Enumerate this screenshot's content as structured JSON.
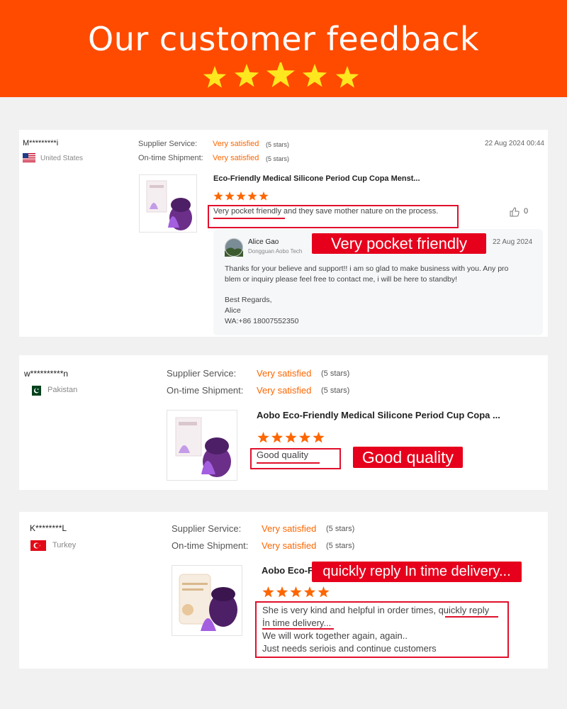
{
  "banner": {
    "title": "Our customer feedback",
    "rating_stars": 5,
    "star_color": "#ffe71f"
  },
  "colors": {
    "brand_orange": "#fe4b00",
    "satisfied_orange": "#fe6600",
    "highlight_red": "#e1102c"
  },
  "reviews": [
    {
      "buyer": "M*********i",
      "country": "United States",
      "supplier_label": "Supplier Service:",
      "supplier_value": "Very satisfied",
      "supplier_stars": "(5 stars)",
      "shipment_label": "On-time Shipment:",
      "shipment_value": "Very satisfied",
      "shipment_stars": "(5 stars)",
      "date": "22 Aug 2024 00:44",
      "product": "Eco-Friendly Medical Silicone Period Cup Copa Menst...",
      "rating": 5,
      "comment": "Very pocket friendly and they save mother nature on the process.",
      "likes": "0",
      "callout": "Very pocket friendly",
      "reply": {
        "name": "Alice Gao",
        "company": "Dongguan Aobo Tech",
        "date": "22 Aug 2024",
        "line1": "Thanks for your believe and support!! i am so glad to make business with you. Any pro",
        "line2": "blem or inquiry please feel free to contact me, i will be here to standby!",
        "line3": "Best Regards,",
        "line4": "Alice",
        "line5": "WA:+86 18007552350"
      }
    },
    {
      "buyer": "w**********n",
      "country": "Pakistan",
      "supplier_label": "Supplier Service:",
      "supplier_value": "Very satisfied",
      "supplier_stars": "(5 stars)",
      "shipment_label": "On-time Shipment:",
      "shipment_value": "Very satisfied",
      "shipment_stars": "(5 stars)",
      "product": "Aobo Eco-Friendly Medical Silicone Period Cup Copa ...",
      "rating": 5,
      "comment": "Good quality",
      "callout": "Good quality"
    },
    {
      "buyer": "K********L",
      "country": "Turkey",
      "supplier_label": "Supplier Service:",
      "supplier_value": "Very satisfied",
      "supplier_stars": "(5 stars)",
      "shipment_label": "On-time Shipment:",
      "shipment_value": "Very satisfied",
      "shipment_stars": "(5 stars)",
      "product": "Aobo Eco-F",
      "rating": 5,
      "comment_line1": "She is very kind and helpful in order times, quickly reply",
      "comment_line2": "İn time delivery...",
      "comment_line3": "We will work together again, again..",
      "comment_line4": "Just needs seriois and continue customers",
      "callout": "quickly reply In time delivery..."
    }
  ]
}
